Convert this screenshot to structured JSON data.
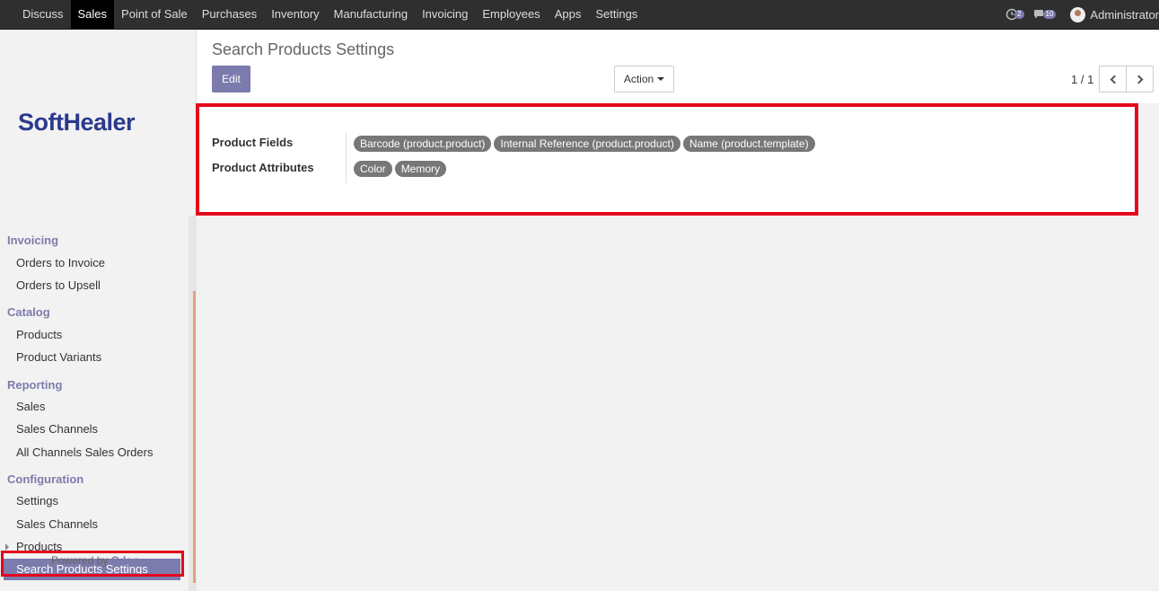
{
  "topbar": {
    "menu": [
      "Discuss",
      "Sales",
      "Point of Sale",
      "Purchases",
      "Inventory",
      "Manufacturing",
      "Invoicing",
      "Employees",
      "Apps",
      "Settings"
    ],
    "active_menu": "Sales",
    "activity_count": "2",
    "messages_count": "10",
    "user_name": "Administrator"
  },
  "sidebar": {
    "logo_text": "SoftHealer",
    "sections": [
      {
        "title": "Invoicing",
        "items": [
          "Orders to Invoice",
          "Orders to Upsell"
        ]
      },
      {
        "title": "Catalog",
        "items": [
          "Products",
          "Product Variants"
        ]
      },
      {
        "title": "Reporting",
        "items": [
          "Sales",
          "Sales Channels",
          "All Channels Sales Orders"
        ]
      },
      {
        "title": "Configuration",
        "items": [
          "Settings",
          "Sales Channels",
          "Products",
          "Search Products Settings"
        ]
      }
    ],
    "active_item": "Search Products Settings",
    "powered_by_prefix": "Powered by",
    "powered_by_brand": "Odoo"
  },
  "control_panel": {
    "breadcrumb": "Search Products Settings",
    "edit_label": "Edit",
    "action_label": "Action",
    "pager_value": "1 / 1"
  },
  "form": {
    "product_fields_label": "Product Fields",
    "product_fields_tags": [
      "Barcode (product.product)",
      "Internal Reference (product.product)",
      "Name (product.template)"
    ],
    "product_attributes_label": "Product Attributes",
    "product_attributes_tags": [
      "Color",
      "Memory"
    ]
  },
  "colors": {
    "brand": "#7c7bad",
    "navbar": "#2f2f2f",
    "highlight": "#e4061c",
    "tag": "#777777"
  }
}
